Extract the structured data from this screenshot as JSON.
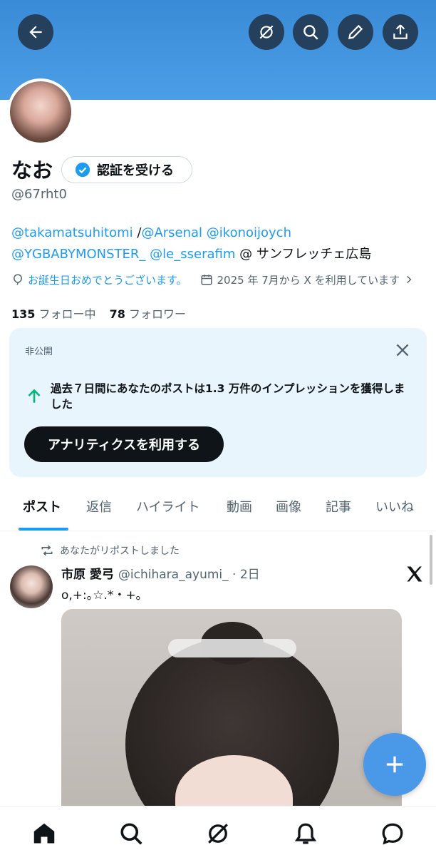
{
  "profile": {
    "display_name": "なお",
    "handle": "@67rht0",
    "verify_label": "認証を受ける",
    "bio": {
      "line1_mention1": "@takamatsuhitomi",
      "line1_sep": " /",
      "line1_mention2": "@Arsenal",
      "line1_mention3": "@ikonoijoych",
      "line2_mention1": "@YGBABYMONSTER_",
      "line2_mention2": "@le_sserafim",
      "line2_text": " @ サンフレッチェ広島"
    },
    "birthday_text": "お誕生日おめでとうございます。",
    "joined_text": "2025 年 7月から X を利用しています",
    "following_count": "135",
    "following_label": "フォロー中",
    "followers_count": "78",
    "followers_label": "フォロワー"
  },
  "analytics_card": {
    "privacy_label": "非公開",
    "message": "過去７日間にあなたのポストは1.3 万件のインプレッションを獲得しました",
    "cta_label": "アナリティクスを利用する"
  },
  "tabs": [
    "ポスト",
    "返信",
    "ハイライト",
    "動画",
    "画像",
    "記事",
    "いいね"
  ],
  "active_tab": "ポスト",
  "post": {
    "repost_label": "あなたがリポストしました",
    "author_name": "市原 愛弓",
    "author_handle": "@ichihara_ayumi_ · 2日",
    "text": "o,+:｡☆.*・+｡"
  },
  "colors": {
    "accent": "#1d9bf0",
    "banner": "#4b9ee6",
    "header_button": "#24405c",
    "card_bg": "#e8f5fd",
    "fab": "#4a99e9",
    "positive": "#00ba7c"
  },
  "icons": {
    "header": [
      "back-arrow-icon",
      "grok-icon",
      "search-icon",
      "edit-pencil-icon",
      "share-icon"
    ],
    "bottom_nav": [
      "home-icon",
      "search-icon",
      "grok-icon",
      "bell-icon",
      "messages-icon"
    ]
  }
}
